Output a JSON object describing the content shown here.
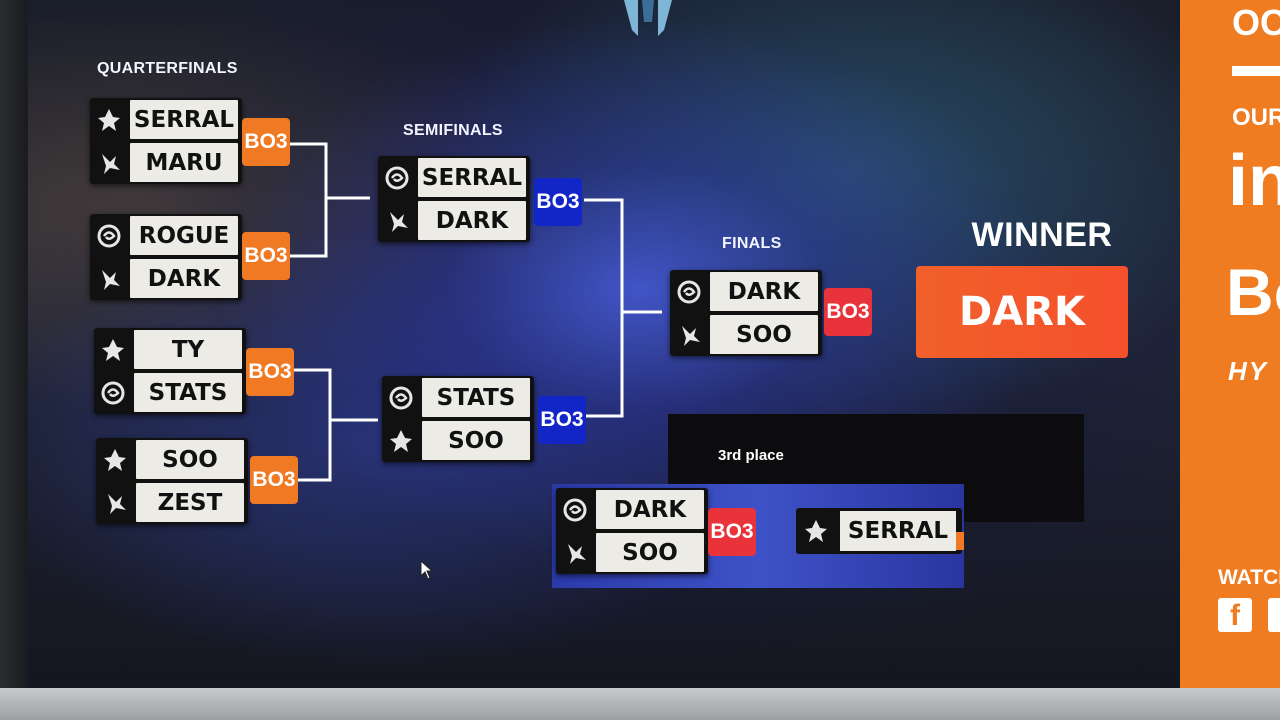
{
  "labels": {
    "quarterfinals": "QUARTERFINALS",
    "semifinals": "SEMIFINALS",
    "finals": "FINALS",
    "winner": "WINNER",
    "third_place": "3rd place"
  },
  "quarterfinals": [
    {
      "p1": "SERRAL",
      "p1_race": "terran-icon",
      "p2": "MARU",
      "p2_race": "protoss-icon",
      "format": "BO3"
    },
    {
      "p1": "ROGUE",
      "p1_race": "zerg-icon",
      "p2": "DARK",
      "p2_race": "protoss-icon",
      "format": "BO3"
    },
    {
      "p1": "TY",
      "p1_race": "terran-icon",
      "p2": "STATS",
      "p2_race": "zerg-icon",
      "format": "BO3"
    },
    {
      "p1": "SOO",
      "p1_race": "terran-icon",
      "p2": "ZEST",
      "p2_race": "protoss-icon",
      "format": "BO3"
    }
  ],
  "semifinals": [
    {
      "p1": "SERRAL",
      "p1_race": "zerg-icon",
      "p2": "DARK",
      "p2_race": "protoss-icon",
      "format": "BO3"
    },
    {
      "p1": "STATS",
      "p1_race": "zerg-icon",
      "p2": "SOO",
      "p2_race": "terran-icon",
      "format": "BO3"
    }
  ],
  "finals": {
    "p1": "DARK",
    "p1_race": "zerg-icon",
    "p2": "SOO",
    "p2_race": "protoss-icon",
    "format": "BO3"
  },
  "winner": "DARK",
  "third_place_match": {
    "p1": "DARK",
    "p1_race": "zerg-icon",
    "p2": "SOO",
    "p2_race": "protoss-icon",
    "format": "BO3"
  },
  "third_place_result": {
    "name": "SERRAL",
    "race": "terran-icon"
  },
  "sidebar": {
    "top": "OC",
    "our": "OUR S",
    "big1": "in",
    "big2": "Bo",
    "sponsor": "HY",
    "watch": "WATCH"
  },
  "colors": {
    "orange": "#f07a24",
    "blue": "#1226c8",
    "red": "#e8333a",
    "winner": "#f1602a"
  }
}
